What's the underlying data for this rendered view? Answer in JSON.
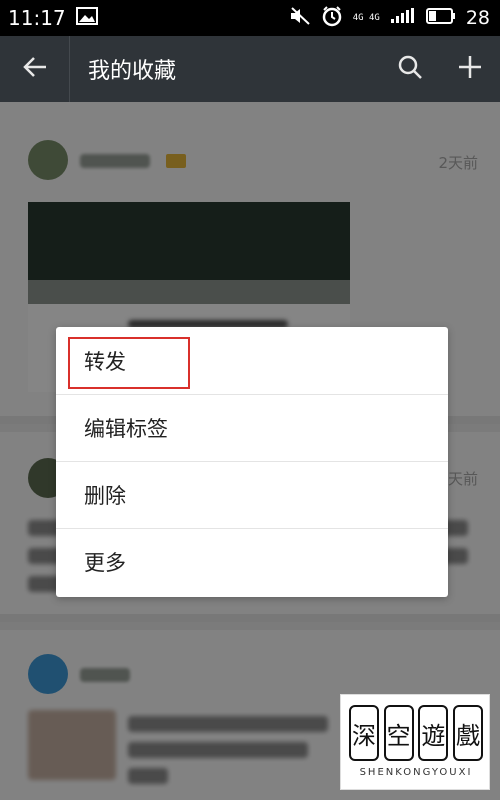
{
  "status_bar": {
    "time": "11:17",
    "network_label": "4G 4G",
    "battery_text": "28"
  },
  "app_bar": {
    "title": "我的收藏",
    "back_icon": "arrow-left-icon",
    "search_icon": "search-icon",
    "add_icon": "plus-icon",
    "background": "#2f3439"
  },
  "cards": [
    {
      "time": "2天前"
    },
    {
      "time": "天前"
    },
    {
      "time": ""
    }
  ],
  "context_menu": {
    "items": [
      {
        "label": "转发",
        "highlighted": true
      },
      {
        "label": "编辑标签"
      },
      {
        "label": "删除"
      },
      {
        "label": "更多"
      }
    ],
    "highlight_color": "#d9302b"
  },
  "watermark": {
    "chars": [
      "深",
      "空",
      "遊",
      "戲"
    ],
    "subtitle": "SHENKONGYOUXI"
  }
}
